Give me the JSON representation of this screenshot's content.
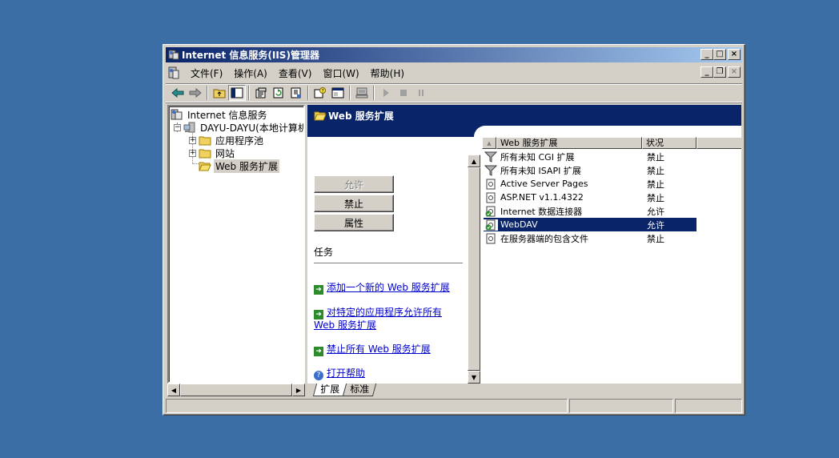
{
  "window": {
    "title": "Internet 信息服务(IIS)管理器",
    "caption_min": "_",
    "caption_max": "□",
    "caption_close": "×"
  },
  "menu": {
    "items": [
      "文件(F)",
      "操作(A)",
      "查看(V)",
      "窗口(W)",
      "帮助(H)"
    ],
    "mdi_min": "_",
    "mdi_restore": "❐",
    "mdi_close": "×"
  },
  "toolbar": {
    "icons": [
      "back-arrow-icon",
      "forward-arrow-icon",
      "up-folder-icon",
      "show-tree-icon",
      "properties-icon",
      "refresh-icon",
      "export-icon",
      "help-icon",
      "console-icon",
      "computer-icon",
      "play-icon",
      "stop-icon",
      "pause-icon"
    ]
  },
  "tree": {
    "root": "Internet 信息服务",
    "server": "DAYU-DAYU(本地计算机)",
    "expander_collapse": "−",
    "expander_expand": "+",
    "children": [
      "应用程序池",
      "网站",
      "Web 服务扩展"
    ]
  },
  "rightpane": {
    "banner_title": "Web 服务扩展",
    "buttons": {
      "allow": "允许",
      "prohibit": "禁止",
      "properties": "属性"
    },
    "tasks_heading": "任务",
    "tasks": [
      "添加一个新的 Web 服务扩展",
      "对特定的应用程序允许所有 Web 服务扩展",
      "禁止所有 Web 服务扩展",
      "打开帮助"
    ],
    "task_arrow_glyph": "➜",
    "task_help_glyph": "?"
  },
  "listview": {
    "sort_glyph": "▲",
    "columns": [
      "Web 服务扩展",
      "状况"
    ],
    "rows": [
      {
        "name": "所有未知 CGI 扩展",
        "status": "禁止",
        "icon": "filter-icon"
      },
      {
        "name": "所有未知 ISAPI 扩展",
        "status": "禁止",
        "icon": "filter-icon"
      },
      {
        "name": "Active Server Pages",
        "status": "禁止",
        "icon": "extension-doc-icon"
      },
      {
        "name": "ASP.NET v1.1.4322",
        "status": "禁止",
        "icon": "extension-doc-icon"
      },
      {
        "name": "Internet 数据连接器",
        "status": "允许",
        "icon": "allowed-extension-icon"
      },
      {
        "name": "WebDAV",
        "status": "允许",
        "icon": "allowed-extension-icon",
        "selected": true
      },
      {
        "name": "在服务器端的包含文件",
        "status": "禁止",
        "icon": "extension-doc-icon"
      }
    ]
  },
  "tabs": [
    "扩展",
    "标准"
  ],
  "scroll_glyphs": {
    "left": "◀",
    "right": "▶",
    "up": "▲",
    "down": "▼"
  },
  "colors": {
    "titlebar": "#0a246a",
    "selection": "#0a246a",
    "link": "#0000cc",
    "desktop": "#3a6ea5"
  }
}
